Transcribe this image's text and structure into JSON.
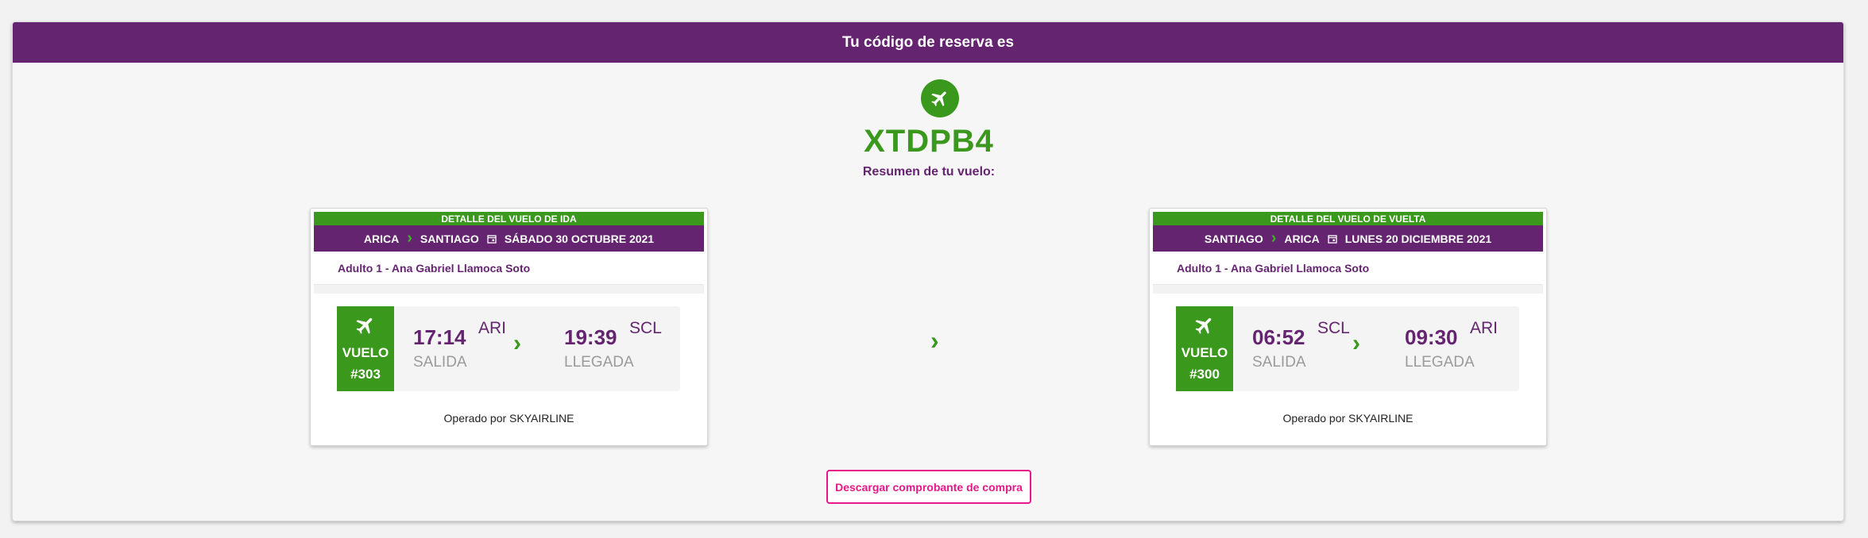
{
  "header": {
    "title": "Tu código de reserva es"
  },
  "reservation": {
    "code": "XTDPB4",
    "summary_label": "Resumen de tu vuelo:"
  },
  "outbound": {
    "title": "Detalle del vuelo de ida",
    "origin": "ARICA",
    "destination": "SANTIAGO",
    "date": "SÁBADO 30 OCTUBRE 2021",
    "passenger": "Adulto 1 - Ana Gabriel Llamoca Soto",
    "flight_label": "VUELO",
    "flight_number": "#303",
    "departure_time": "17:14",
    "departure_code": "ARI",
    "departure_label": "SALIDA",
    "arrival_time": "19:39",
    "arrival_code": "SCL",
    "arrival_label": "LLEGADA",
    "operated_by": "Operado por SKYAIRLINE"
  },
  "return": {
    "title": "Detalle del vuelo de vuelta",
    "origin": "SANTIAGO",
    "destination": "ARICA",
    "date": "LUNES 20 DICIEMBRE 2021",
    "passenger": "Adulto 1 - Ana Gabriel Llamoca Soto",
    "flight_label": "VUELO",
    "flight_number": "#300",
    "departure_time": "06:52",
    "departure_code": "SCL",
    "departure_label": "SALIDA",
    "arrival_time": "09:30",
    "arrival_code": "ARI",
    "arrival_label": "LLEGADA",
    "operated_by": "Operado por SKYAIRLINE"
  },
  "actions": {
    "download_label": "Descargar comprobante de compra"
  },
  "icons": {
    "plane": "plane-icon",
    "calendar": "calendar-icon",
    "chevron": "chevron-right-icon"
  },
  "colors": {
    "primary_purple": "#652470",
    "accent_green": "#3a981d",
    "button_pink": "#e8178a"
  }
}
